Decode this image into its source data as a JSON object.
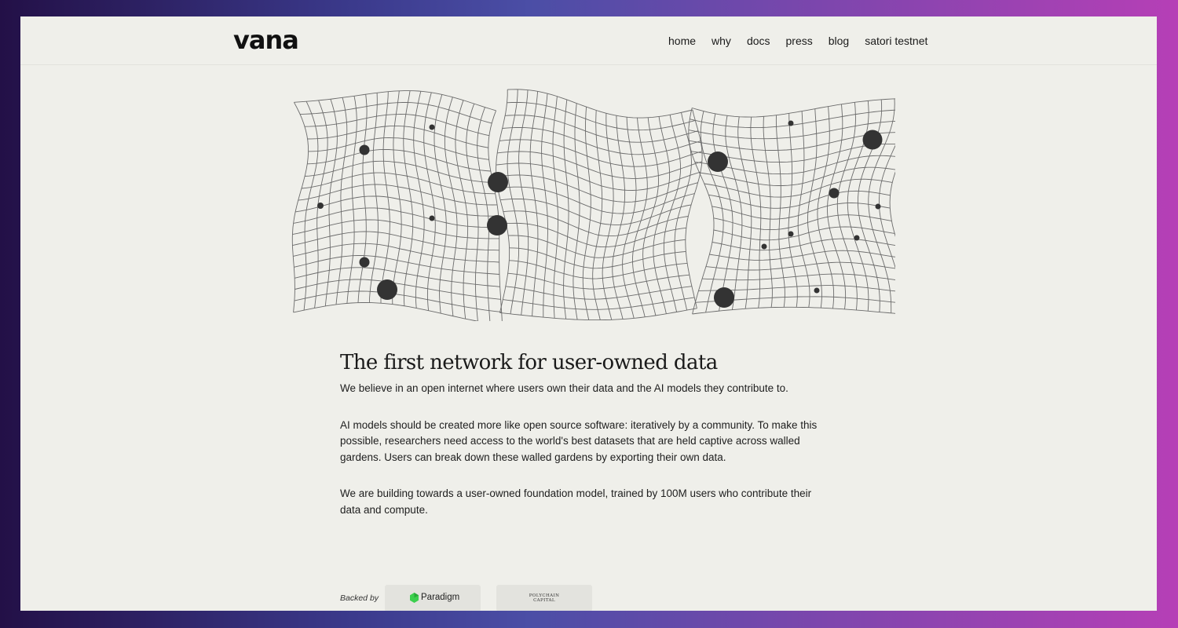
{
  "header": {
    "logo": "vana",
    "nav": [
      "home",
      "why",
      "docs",
      "press",
      "blog",
      "satori testnet"
    ]
  },
  "hero": {
    "graphic": "warped-grid-with-dots"
  },
  "main": {
    "headline": "The first network for user-owned data",
    "paragraphs": [
      "We believe in an open internet where users own their data and the AI models they contribute to.",
      "AI models should be created more like open source software: iteratively by a community. To make this possible, researchers need access to the world's best datasets that are held captive across walled gardens. Users can break down these walled gardens by exporting their own data.",
      "We are building towards a user-owned foundation model, trained by 100M users who contribute their data and compute."
    ]
  },
  "backers": {
    "label": "Backed by",
    "items": [
      {
        "name": "Paradigm",
        "icon": "paradigm-logo-icon",
        "color": "#3ccf4e"
      },
      {
        "name": "POLYCHAIN\nCAPITAL",
        "icon": "polychain-capital-logo"
      }
    ]
  },
  "colors": {
    "page_background": "#efefea",
    "text": "#1a1a1a",
    "grid_line": "#6b6b6b",
    "dot": "#333333",
    "accent_gradient_left": "#231047",
    "accent_gradient_right": "#b63fb6"
  }
}
